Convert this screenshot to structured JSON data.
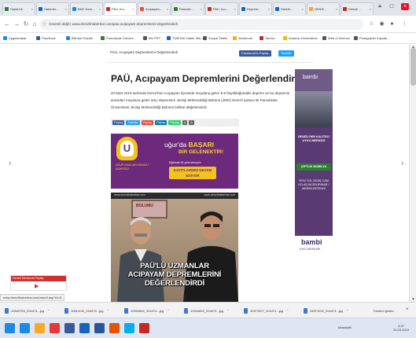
{
  "browser": {
    "tabs": [
      {
        "label": "Sayfa bil...",
        "color": "#2e7d32"
      },
      {
        "label": "Haberler...",
        "color": "#1565c0"
      },
      {
        "label": "BNC Dern...",
        "color": "#1e88e5"
      },
      {
        "label": "PAÜ, Acı...",
        "color": "#c62828",
        "active": true
      },
      {
        "label": "Acıpayam...",
        "color": "#f4511e"
      },
      {
        "label": "Pamukk...",
        "color": "#2e7d32"
      },
      {
        "label": "PAÜ, Acı...",
        "color": "#c62828"
      },
      {
        "label": "Deprem...",
        "color": "#1565c0"
      },
      {
        "label": "Denizli...",
        "color": "#1565c0"
      },
      {
        "label": "DENIZ...",
        "color": "#f9a825"
      },
      {
        "label": "Denizli ...",
        "color": "#c62828"
      }
    ],
    "address": "Güvenli değil | www.denizlihaberbar.com/pau-acipayam-depremlerini-degerlendirdi",
    "bookmarks": [
      {
        "label": "Uygulamalar",
        "color": "#1e88e5"
      },
      {
        "label": "Facebook",
        "color": "#3b5998"
      },
      {
        "label": "Bilimsel Sözlük",
        "color": "#1e88e5"
      },
      {
        "label": "Pamukkale Ünivers...",
        "color": "#2e7d32"
      },
      {
        "label": "MU.PET",
        "color": "#555555"
      },
      {
        "label": "TÜBİTAK Haber Mrk...",
        "color": "#1565c0"
      },
      {
        "label": "Sosyal Siteler",
        "color": "#555555"
      },
      {
        "label": "Workbook",
        "color": "#f9a825"
      },
      {
        "label": "Tanıtıcı",
        "color": "#c62828"
      },
      {
        "label": "Anadolu Üniversitesi",
        "color": "#ffb300"
      },
      {
        "label": "Web of Science",
        "color": "#555555"
      },
      {
        "label": "Pedagojinin Kaynak...",
        "color": "#555555"
      }
    ]
  },
  "site": {
    "breadcrumb": "PAÜ, Acıpayam Depremlerini Değerlendirdi",
    "facebook_btn": "Facebook'ta Paylaş",
    "twitter_btn": "Tweetle"
  },
  "article": {
    "title": "PAÜ, Acıpayam Depremlerini Değerlendirdi",
    "body": "20 Mart 2019 tarihinde Denizli'nin Acıpayam ilçesinde meydana gelen 5.5 büyüklüğündeki deprem ve bu depremin ardından meydana gelen artçı depremleri Jeoloji Mühendisliği Bölümü (JMO) Denizli Şubesi ile Pamukkale Üniversitesi Jeoloji Mühendisliği Bölümü birlikte değerlendirdi.",
    "share": [
      {
        "label": "Paylaş",
        "color": "#3b5998"
      },
      {
        "label": "Tweetle",
        "color": "#1da1f2"
      },
      {
        "label": "Paylaş",
        "color": "#dd4b39"
      },
      {
        "label": "Paylaş",
        "color": "#0077b5"
      },
      {
        "label": "Paylaş",
        "color": "#25d366"
      },
      {
        "label": "A",
        "color": "#666666"
      },
      {
        "label": "A",
        "color": "#666666"
      }
    ]
  },
  "ad_ugur": {
    "line1_a": "uğur'da ",
    "line1_b": "BAŞARI",
    "line2": "BİR GELENEKTİR!",
    "sub": "Eğitimde 52 yıllık deneyim",
    "badge": "KAYITLARIMIZ DEVAM EDİYOR",
    "school": "UĞUR OKULLARI DENİZLİ KAMPÜSÜ"
  },
  "article_image": {
    "site_left": "www.denizlihaberbar.com",
    "site_right": "www.denizlihaberbar.com",
    "poster": "BOLUMU",
    "caption_line1": "PAÜ'LÜ UZMANLAR",
    "caption_line2": "ACIPAYAM DEPREMLERİNİ",
    "caption_line3": "DEĞERLENDİRDİ"
  },
  "ad_right": {
    "logo_top": "bambi",
    "block1": "DENİZLİ'NİN KALİTELİ UYKU MERKEZİ",
    "block2": "ÇİFTLİK MOBİLYA",
    "block3": "YENİ YOL GİDİŞ CAM KO-45 İNCİRLİPINAR / MERKEZEFENDİ",
    "logo_bottom": "bambi",
    "logo_bottom_sub": "UYKU ÜRÜNLERİ"
  },
  "mini_player": {
    "title": "Denizli Merkezde Paylaş"
  },
  "status_url": "www.denizlihaberbar.com/arsivli.asp?id=5",
  "downloads": {
    "items": [
      "10543763_204474...jpg",
      "10511132_204474...jpg",
      "10520652_204474...jpg",
      "10334652_204474...jpg",
      "10571527_204474...jpg",
      "34571032_204474...jpg"
    ],
    "show_all": "Tümünü göster"
  },
  "taskbar": {
    "apps": [
      {
        "name": "start",
        "color": "#1e88e5"
      },
      {
        "name": "ie",
        "color": "#1e88e5"
      },
      {
        "name": "explorer",
        "color": "#f9a825"
      },
      {
        "name": "chrome",
        "color": "#e53935"
      },
      {
        "name": "facebook",
        "color": "#3b5998"
      },
      {
        "name": "outlook",
        "color": "#1565c0"
      },
      {
        "name": "word",
        "color": "#2b579a"
      },
      {
        "name": "media",
        "color": "#e65100"
      },
      {
        "name": "skype",
        "color": "#00aff0"
      },
      {
        "name": "acrobat",
        "color": "#c62828"
      }
    ],
    "tray": "Masaüstü",
    "time": "9:37",
    "date": "20.03.2019"
  },
  "colors": {
    "accent_red": "#c62828",
    "ad_purple": "#6d2a7c",
    "ad_gold": "#f9d026"
  }
}
